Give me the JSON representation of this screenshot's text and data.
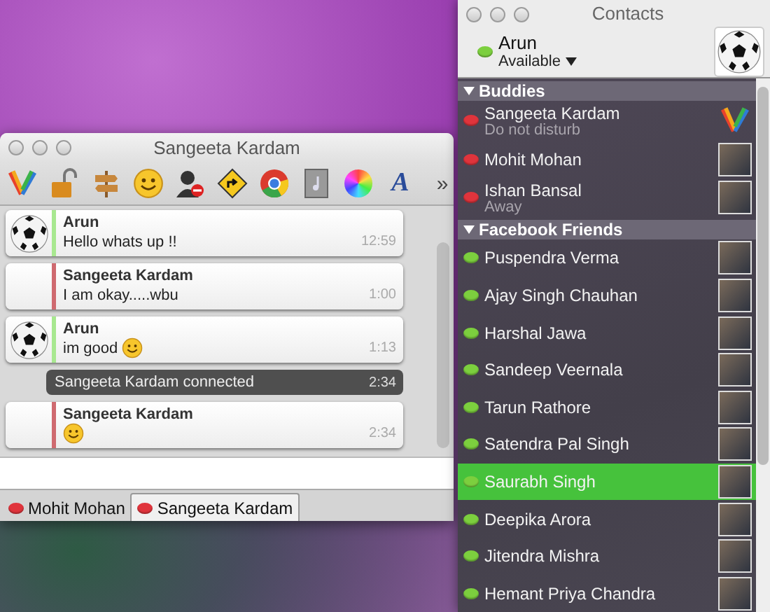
{
  "chat_window": {
    "title": "Sangeeta Kardam",
    "toolbar": {
      "font_button": "A",
      "overflow_button": "»"
    },
    "messages": [
      {
        "kind": "outgoing",
        "sender": "Arun",
        "text": "Hello whats up !!",
        "emoticon": false,
        "time": "12:59"
      },
      {
        "kind": "incoming",
        "sender": "Sangeeta Kardam",
        "text": "I am okay.....wbu",
        "emoticon": false,
        "time": "1:00"
      },
      {
        "kind": "outgoing",
        "sender": "Arun",
        "text": "im good",
        "emoticon": true,
        "time": "1:13"
      },
      {
        "kind": "status",
        "text": "Sangeeta Kardam connected",
        "time": "2:34"
      },
      {
        "kind": "incoming",
        "sender": "Sangeeta Kardam",
        "emoticon": true,
        "time": "2:34"
      }
    ],
    "tabs": [
      {
        "label": "Mohit Mohan",
        "selected": false,
        "color": "#e0343c"
      },
      {
        "label": "Sangeeta Kardam",
        "selected": true,
        "color": "#e0343c"
      }
    ]
  },
  "contacts_window": {
    "title": "Contacts",
    "user": {
      "name": "Arun",
      "status": "Available",
      "color": "#7ccf3e"
    },
    "groups": [
      {
        "name": "Buddies",
        "expanded": true,
        "contacts": [
          {
            "name": "Sangeeta Kardam",
            "status": "Do not disturb",
            "color": "#e0343c",
            "kind": "logo",
            "selected": false
          },
          {
            "name": "Mohit Mohan",
            "color": "#e0343c",
            "kind": "photo",
            "selected": false
          },
          {
            "name": "Ishan Bansal",
            "status": "Away",
            "color": "#e0343c",
            "kind": "photo",
            "selected": false
          }
        ]
      },
      {
        "name": "Facebook Friends",
        "expanded": true,
        "contacts": [
          {
            "name": "Puspendra Verma",
            "color": "#7ccf3e",
            "kind": "photo",
            "selected": false
          },
          {
            "name": "Ajay Singh Chauhan",
            "color": "#7ccf3e",
            "kind": "photo",
            "selected": false
          },
          {
            "name": "Harshal Jawa",
            "color": "#7ccf3e",
            "kind": "photo",
            "selected": false
          },
          {
            "name": "Sandeep Veernala",
            "color": "#7ccf3e",
            "kind": "photo",
            "selected": false
          },
          {
            "name": "Tarun Rathore",
            "color": "#7ccf3e",
            "kind": "photo",
            "selected": false
          },
          {
            "name": "Satendra Pal Singh",
            "color": "#7ccf3e",
            "kind": "photo",
            "selected": false
          },
          {
            "name": "Saurabh Singh",
            "color": "#7ccf3e",
            "kind": "photo",
            "selected": true
          },
          {
            "name": "Deepika Arora",
            "color": "#7ccf3e",
            "kind": "photo",
            "selected": false
          },
          {
            "name": "Jitendra Mishra",
            "color": "#7ccf3e",
            "kind": "photo",
            "selected": false
          },
          {
            "name": "Hemant Priya Chandra",
            "color": "#7ccf3e",
            "kind": "photo",
            "selected": false
          }
        ]
      }
    ]
  }
}
